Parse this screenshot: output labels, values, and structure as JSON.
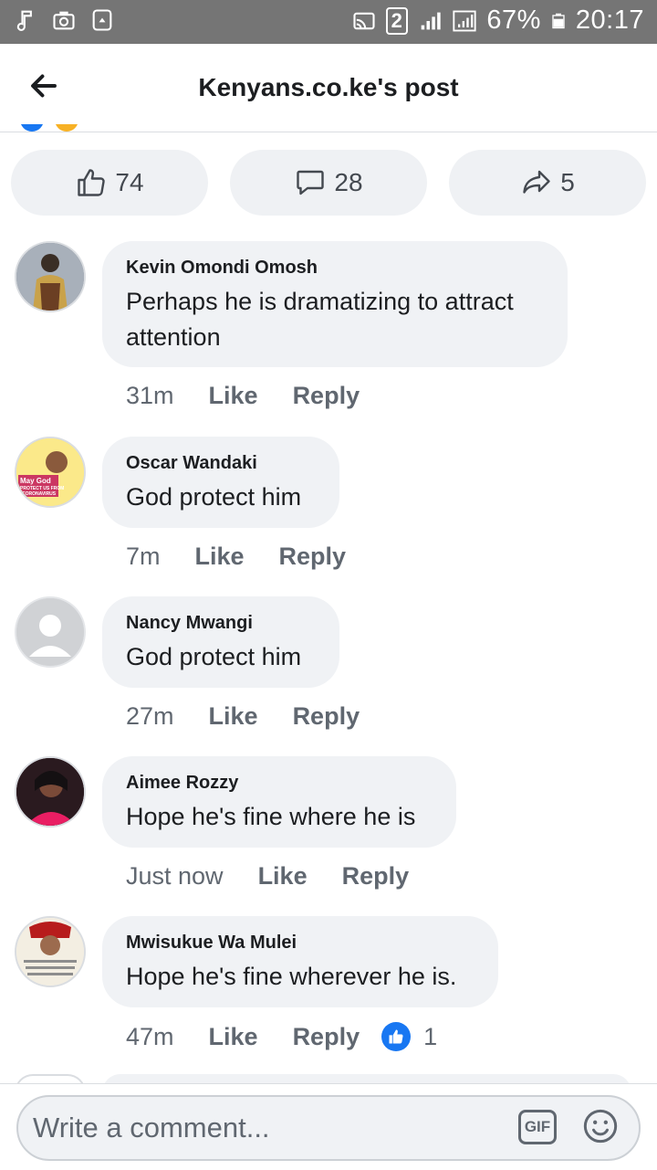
{
  "status_bar": {
    "sim": "2",
    "battery": "67%",
    "time": "20:17"
  },
  "header": {
    "title": "Kenyans.co.ke's post"
  },
  "actions": {
    "likes": "74",
    "comments": "28",
    "shares": "5"
  },
  "comments": [
    {
      "author": "Kevin Omondi Omosh",
      "text": "Perhaps he is dramatizing to attract attention",
      "time": "31m",
      "like_label": "Like",
      "reply_label": "Reply"
    },
    {
      "author": "Oscar Wandaki",
      "text": "God protect him",
      "time": "7m",
      "like_label": "Like",
      "reply_label": "Reply",
      "avatar_text": [
        "May God",
        "PROTECT US FROM",
        "CORONAVIRUS"
      ]
    },
    {
      "author": "Nancy Mwangi",
      "text": "God protect him",
      "time": "27m",
      "like_label": "Like",
      "reply_label": "Reply"
    },
    {
      "author": "Aimee Rozzy",
      "text": "Hope he's fine where he is",
      "time": "Just now",
      "like_label": "Like",
      "reply_label": "Reply"
    },
    {
      "author": "Mwisukue Wa Mulei",
      "text": "Hope he's fine wherever he is.",
      "time": "47m",
      "like_label": "Like",
      "reply_label": "Reply",
      "reactions": "1"
    }
  ],
  "composer": {
    "placeholder": "Write a comment...",
    "gif_label": "GIF"
  },
  "colors": {
    "accent": "#1877f2",
    "bubble": "#f0f2f5",
    "status_bar": "#757575"
  }
}
